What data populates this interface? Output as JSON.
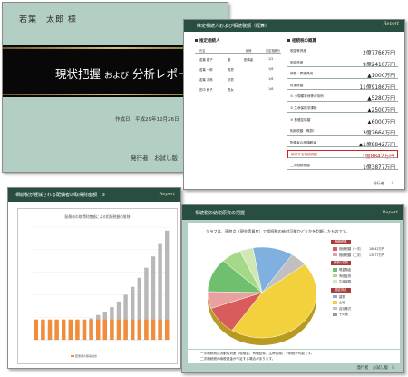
{
  "cover": {
    "client_name": "若葉　太郎 様",
    "title_main1": "現状把握",
    "title_connector": "および",
    "title_main2": "分析レポート",
    "date_line": "作成日　平成29年12月26日",
    "publisher_line": "発行者　お試し版"
  },
  "summary": {
    "header_title": "推定相続人および相続税額（概算）",
    "logo": "Report",
    "heirs_section_title": "推定相続人",
    "heirs_columns": [
      "氏名",
      "続柄",
      "法定相続分"
    ],
    "heirs": [
      {
        "name": "若葉 春子",
        "relation": "妻",
        "status": "配偶者",
        "share": "1/2"
      },
      {
        "name": "若葉 一郎",
        "relation": "長男",
        "status": "",
        "share": "1/6"
      },
      {
        "name": "若葉 次郎",
        "relation": "次男",
        "status": "",
        "share": "1/6"
      },
      {
        "name": "田中 和子",
        "relation": "長女",
        "status": "",
        "share": "1/6"
      }
    ],
    "tax_section_title": "相続税の概算",
    "tax_rows": [
      {
        "label": "現金等資産",
        "value": "2億7766万円",
        "highlight": false
      },
      {
        "label": "固定資産",
        "value": "9億2410万円",
        "highlight": false
      },
      {
        "label": "債務・葬儀費用",
        "value": "▲1000万円",
        "highlight": false
      },
      {
        "label": "財産総額",
        "value": "11億9186万円",
        "highlight": false
      },
      {
        "label": "① 小規模宅地等の特例",
        "value": "▲5280万円",
        "highlight": false
      },
      {
        "label": "② 生命保険非課税",
        "value": "▲2500万円",
        "highlight": false
      },
      {
        "label": "③ 基礎控除額",
        "value": "▲6000万円",
        "highlight": false
      },
      {
        "label": "相続税額（概算）",
        "value": "3億7664万円",
        "highlight": false
      },
      {
        "label": "配偶者の税額軽減",
        "value": "▲1億8842万円",
        "highlight": false
      },
      {
        "label": "納付する相続税額",
        "value": "1億8842万円",
        "highlight": true
      },
      {
        "label": "二次相続税額",
        "value": "1億3877万円",
        "highlight": false
      }
    ],
    "footer": "発行者",
    "page": "4"
  },
  "trend": {
    "header_title": "相続税が軽減される配偶者の取得財産額　②",
    "logo": "Report",
    "chart_title": "配偶者の取得財産額による相続税額の推移",
    "legend_label": "配偶者の取得割合"
  },
  "breakdown": {
    "header_title": "相続税の納税原資の把握",
    "logo": "Report",
    "intro": "グラフは、現時点（現金等資産）で相続税の納付可能かどうかを判断したものです。",
    "legend_groups": [
      {
        "tag": "相続税額",
        "items": [
          {
            "label": "相続税額（一次）",
            "amount": "18842万円",
            "color": "#d85c5c"
          },
          {
            "label": "相続税額（二次）",
            "amount": "13877万円",
            "color": "#e8a0a0"
          }
        ]
      },
      {
        "tag": "納税の原資",
        "items": [
          {
            "label": "現金預金",
            "amount": "",
            "color": "#6fbf6f"
          },
          {
            "label": "有価証券",
            "amount": "",
            "color": "#a6d88a"
          },
          {
            "label": "生命保険",
            "amount": "",
            "color": "#cfe8b4"
          }
        ]
      },
      {
        "tag": "固定資産",
        "items": [
          {
            "label": "建物",
            "amount": "",
            "color": "#7fb0e0"
          },
          {
            "label": "土地",
            "amount": "",
            "color": "#f2d13c"
          },
          {
            "label": "自社株式",
            "amount": "",
            "color": "#c0c0c0"
          },
          {
            "label": "その他",
            "amount": "",
            "color": "#999999"
          }
        ]
      }
    ],
    "note_line1": "一次相続税は流動性資産（現預金、有価証券、生命保険）で納税が可能です。",
    "note_line2": "二次相続税の納税資金が不足する場合があります。",
    "footer": "発行者　お試し版",
    "page": "5"
  },
  "colors": {
    "header_green": "#284e42",
    "cover_bg": "#b3cfc3",
    "bar_gray": "#b8b8b8",
    "bar_orange": "#f08c3c",
    "highlight_red": "#d02020"
  },
  "chart_data": [
    {
      "type": "bar",
      "title": "配偶者の取得財産額による相続税額の推移",
      "series": [
        {
          "name": "",
          "values": [
            12,
            12,
            12,
            13,
            13,
            14,
            15,
            17,
            19,
            22,
            25,
            29,
            34,
            40,
            47,
            55,
            64,
            74,
            85,
            97
          ]
        },
        {
          "name": "配偶者の取得割合",
          "values": [
            18,
            18,
            18,
            18,
            18,
            18,
            18,
            18,
            18,
            18,
            18,
            18,
            18,
            18,
            18,
            18,
            18,
            18,
            18,
            18
          ]
        }
      ]
    },
    {
      "type": "pie",
      "slices": [
        {
          "label": "土地",
          "value": 45,
          "color": "#f2d13c"
        },
        {
          "label": "相続税額（一次）",
          "value": 10,
          "color": "#d85c5c"
        },
        {
          "label": "相続税額（二次）",
          "value": 6,
          "color": "#e8a0a0"
        },
        {
          "label": "現金預金",
          "value": 12,
          "color": "#6fbf6f"
        },
        {
          "label": "有価証券",
          "value": 6,
          "color": "#a6d88a"
        },
        {
          "label": "生命保険",
          "value": 4,
          "color": "#cfe8b4"
        },
        {
          "label": "建物",
          "value": 12,
          "color": "#7fb0e0"
        },
        {
          "label": "その他",
          "value": 5,
          "color": "#c0c0c0"
        }
      ]
    }
  ]
}
